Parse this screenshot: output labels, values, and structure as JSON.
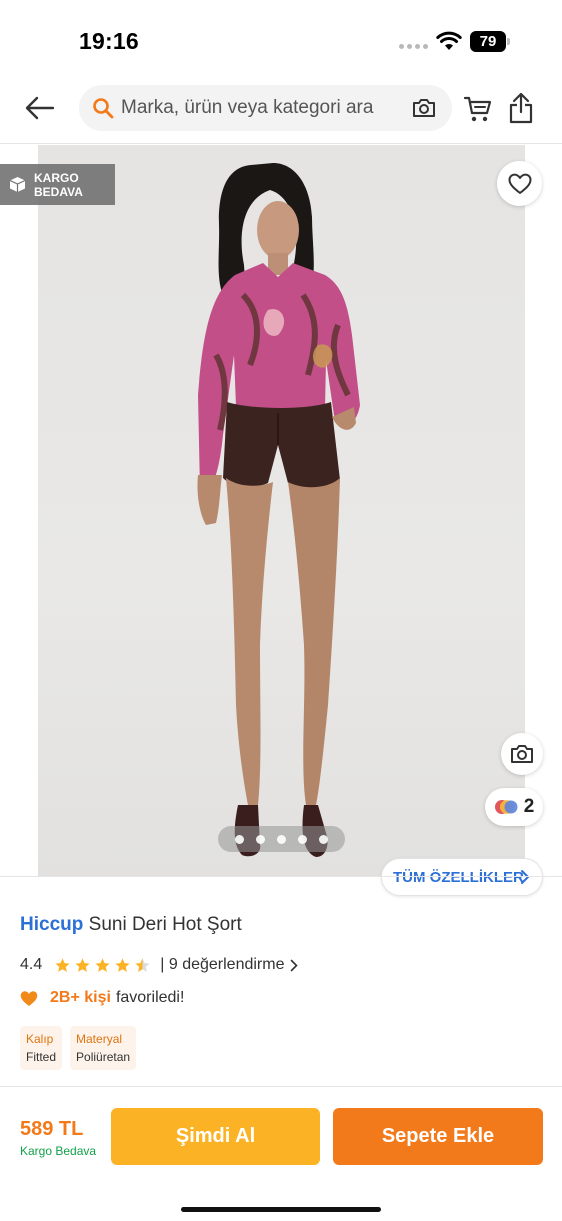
{
  "status_bar": {
    "time": "19:16",
    "battery": "79"
  },
  "header": {
    "search_placeholder": "Marka, ürün veya kategori ara",
    "icons": [
      "back-arrow-icon",
      "search-icon",
      "camera-icon",
      "cart-icon",
      "share-icon"
    ]
  },
  "gallery": {
    "badge": {
      "line1": "KARGO",
      "line2": "BEDAVA"
    },
    "colors_count": "2",
    "all_features_label": "TÜM ÖZELLİKLER",
    "page_count": 5,
    "active_page": 1
  },
  "product": {
    "brand": "Hiccup",
    "name": "Suni Deri Hot Şort",
    "rating": "4.4",
    "rating_value": 4.4,
    "reviews": "| 9 değerlendirme",
    "favorites_count": "2B+ kişi",
    "favorites_text": "favoriledi!",
    "attributes": [
      {
        "key": "Kalıp",
        "value": "Fitted"
      },
      {
        "key": "Materyal",
        "value": "Poliüretan"
      }
    ]
  },
  "purchase": {
    "price": "589 TL",
    "shipping": "Kargo Bedava",
    "buy_now": "Şimdi Al",
    "add_to_cart": "Sepete Ekle"
  },
  "colors": {
    "accent": "#f27a1a",
    "buy_now": "#fbb325",
    "brand_link": "#2c6fd6",
    "free_shipping": "#12a04a",
    "star": "#fbb325"
  }
}
